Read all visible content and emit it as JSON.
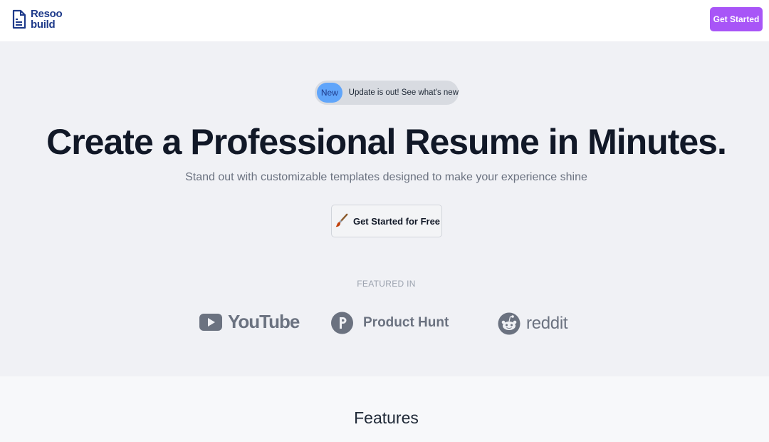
{
  "header": {
    "logo_line1": "Resoo",
    "logo_line2": "build",
    "cta_label": "Get Started"
  },
  "hero": {
    "badge_label": "New",
    "announcement": "Update is out! See what's new",
    "headline": "Create a Professional Resume in Minutes.",
    "subheadline": "Stand out with customizable templates designed to make your experience shine",
    "cta_label": "Get Started for Free",
    "cta_icon": "paintbrush-icon"
  },
  "featured": {
    "label": "FEATURED IN",
    "logos": [
      {
        "name": "YouTube",
        "icon": "youtube-play-icon"
      },
      {
        "name": "Product Hunt",
        "icon": "product-hunt-icon"
      },
      {
        "name": "reddit",
        "icon": "reddit-alien-icon"
      }
    ]
  },
  "features": {
    "title": "Features"
  },
  "colors": {
    "accent": "#a855f7",
    "badge": "#60a5fa",
    "logo": "#1e3a8a",
    "hero_bg": "#f0f1f5"
  }
}
